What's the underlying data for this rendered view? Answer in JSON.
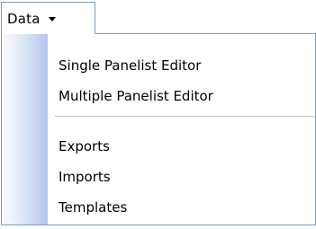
{
  "menu": {
    "label": "Data",
    "icon": "dropdown-arrow-icon",
    "items_group_1": [
      {
        "label": "Single Panelist Editor"
      },
      {
        "label": "Multiple Panelist Editor"
      }
    ],
    "items_group_2": [
      {
        "label": "Exports"
      },
      {
        "label": "Imports"
      },
      {
        "label": "Templates"
      }
    ]
  },
  "colors": {
    "border": "#7f9db9",
    "gutter": "#b5c7ea",
    "separator": "#c5c5c5"
  }
}
